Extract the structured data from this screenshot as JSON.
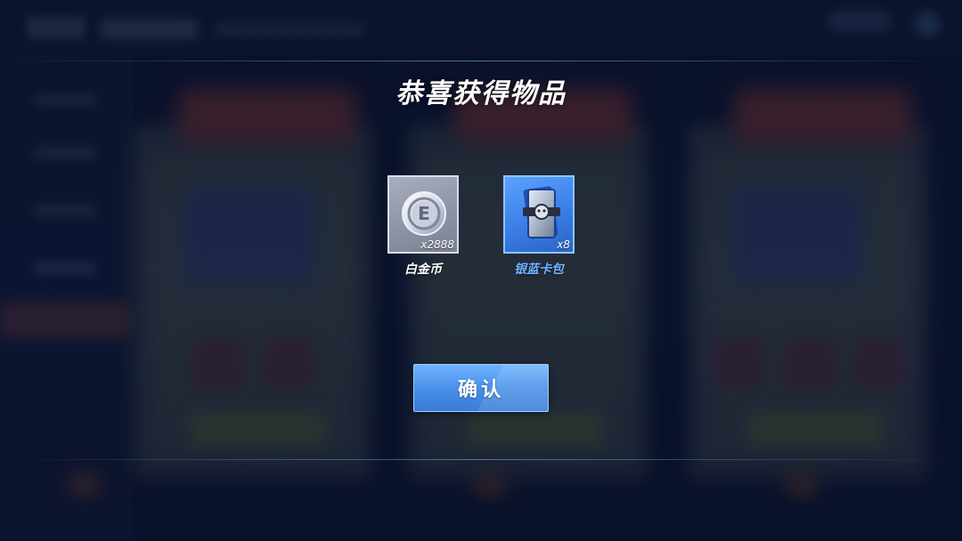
{
  "dialog": {
    "title": "恭喜获得物品",
    "confirm_label": "确认"
  },
  "rewards": [
    {
      "name": "白金币",
      "quantity": "x2888",
      "icon": "platinum-coin-icon",
      "frame_color": "#9aa1b3"
    },
    {
      "name": "银蓝卡包",
      "quantity": "x8",
      "icon": "card-pack-icon",
      "frame_color": "#4a8ff0"
    }
  ],
  "colors": {
    "accent": "#4a90e8",
    "highlight_text": "#6fb2ff",
    "background": "#0b1430"
  }
}
